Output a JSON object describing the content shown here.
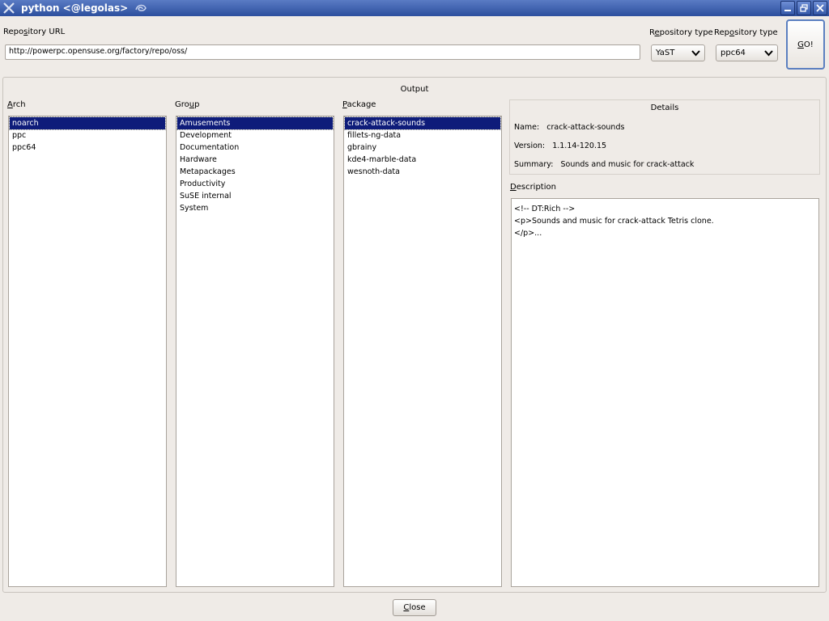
{
  "window": {
    "title": "python <@legolas>",
    "app_icon": "x-close-app-icon",
    "title_icon": "tentacle-icon",
    "buttons": [
      "minimize-icon",
      "restore-icon",
      "close-icon"
    ],
    "titlebar_color": "#2c4f9e"
  },
  "repo_url": {
    "label_pre": "Repo",
    "label_ul": "s",
    "label_post": "itory URL",
    "value": "http://powerpc.opensuse.org/factory/repo/oss/"
  },
  "repo_type_1": {
    "label_pre": "R",
    "label_ul": "e",
    "label_post": "pository type",
    "value": "YaST"
  },
  "repo_type_2": {
    "label_pre": "Rep",
    "label_ul": "o",
    "label_post": "sitory type",
    "value": "ppc64"
  },
  "go_button": {
    "label_ul": "G",
    "label_post": "O!"
  },
  "output_title": "Output",
  "arch": {
    "label_ul": "A",
    "label_post": "rch",
    "items": [
      "noarch",
      "ppc",
      "ppc64"
    ],
    "selected": 0
  },
  "group": {
    "label_pre": "Gro",
    "label_ul": "u",
    "label_post": "p",
    "items": [
      "Amusements",
      "Development",
      "Documentation",
      "Hardware",
      "Metapackages",
      "Productivity",
      "SuSE internal",
      "System"
    ],
    "selected": 0
  },
  "package": {
    "label_ul": "P",
    "label_post": "ackage",
    "items": [
      "crack-attack-sounds",
      "fillets-ng-data",
      "gbrainy",
      "kde4-marble-data",
      "wesnoth-data"
    ],
    "selected": 0
  },
  "details": {
    "title": "Details",
    "name_label": "Name:",
    "name_value": "crack-attack-sounds",
    "version_label": "Version:",
    "version_value": "1.1.14-120.15",
    "summary_label": "Summary:",
    "summary_value": "Sounds and music for crack-attack"
  },
  "description": {
    "label_ul": "D",
    "label_post": "escription",
    "lines": [
      "<!-- DT:Rich -->",
      "<p>Sounds and music for crack-attack Tetris clone.",
      "</p>..."
    ]
  },
  "close_button": {
    "label_ul": "C",
    "label_post": "lose"
  },
  "colors": {
    "selection": "#0e1c7a",
    "window_bg": "#efebe7"
  }
}
